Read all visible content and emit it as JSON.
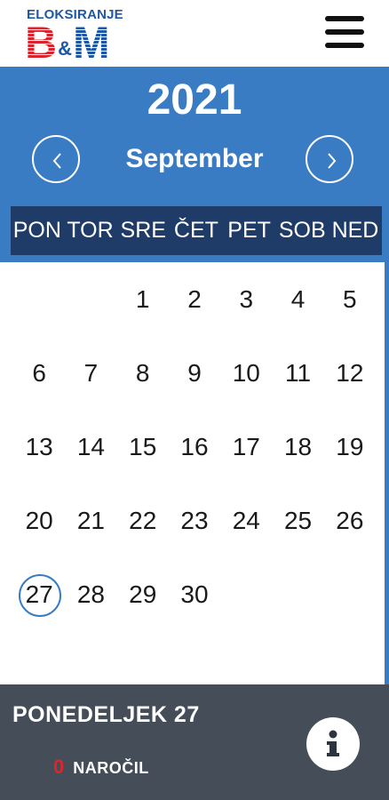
{
  "header": {
    "logo_top": "ELOKSIRANJE",
    "logo_b": "B",
    "logo_amp": "&",
    "logo_m": "M",
    "menu_icon": "hamburger-menu-icon"
  },
  "calendar": {
    "year": "2021",
    "month": "September",
    "prev_icon": "chevron-left-icon",
    "next_icon": "chevron-right-icon",
    "weekdays": [
      "PON",
      "TOR",
      "SRE",
      "ČET",
      "PET",
      "SOB",
      "NED"
    ],
    "weeks": [
      [
        "",
        "",
        "1",
        "2",
        "3",
        "4",
        "5"
      ],
      [
        "6",
        "7",
        "8",
        "9",
        "10",
        "11",
        "12"
      ],
      [
        "13",
        "14",
        "15",
        "16",
        "17",
        "18",
        "19"
      ],
      [
        "20",
        "21",
        "22",
        "23",
        "24",
        "25",
        "26"
      ],
      [
        "27",
        "28",
        "29",
        "30",
        "",
        "",
        ""
      ]
    ],
    "today": "27",
    "accent": "#3a7cc3",
    "weekday_bar": "#1f3c68"
  },
  "footer": {
    "selected_day": "PONEDELJEK 27",
    "orders_count": "0",
    "orders_label": "NAROČIL",
    "info_icon": "info-icon",
    "bg": "#454d59"
  }
}
